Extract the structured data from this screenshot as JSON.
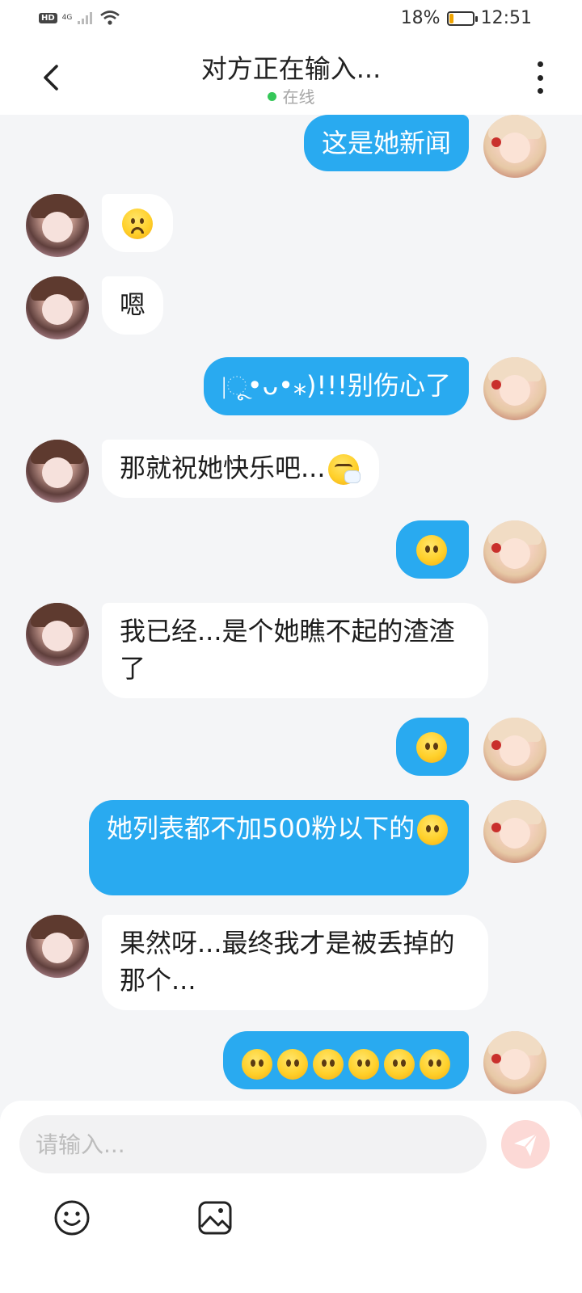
{
  "status_bar": {
    "network_badge": "HD",
    "signal_label": "4G",
    "battery_text": "18%",
    "battery_level": 0.18,
    "time": "12:51"
  },
  "header": {
    "title": "对方正在输入...",
    "status": "在线",
    "online_color": "#35c759"
  },
  "colors": {
    "my_bubble": "#29aaf0",
    "their_bubble": "#ffffff",
    "background": "#f4f5f7",
    "send_button": "#fcd9d6"
  },
  "messages": [
    {
      "side": "me",
      "text": "这是她新闻"
    },
    {
      "side": "them",
      "emoji": "frowning-face-emoji"
    },
    {
      "side": "them",
      "text": "嗯"
    },
    {
      "side": "me",
      "text": "|ૂ•ᴗ•⁎)!!!别伤心了"
    },
    {
      "side": "them",
      "text": "那就祝她快乐吧...",
      "emoji_after": "sneezing-face-emoji"
    },
    {
      "side": "me",
      "emoji": "neutral-face-emoji"
    },
    {
      "side": "them",
      "text": "我已经...是个她瞧不起的渣渣了"
    },
    {
      "side": "me",
      "emoji": "neutral-face-emoji"
    },
    {
      "side": "me",
      "text": "她列表都不加500粉以下的",
      "emoji_after": "neutral-face-emoji"
    },
    {
      "side": "them",
      "text": "果然呀...最终我才是被丢掉的那个..."
    },
    {
      "side": "me",
      "emoji_repeat": "neutral-face-emoji",
      "count": 6
    }
  ],
  "input": {
    "placeholder": "请输入..."
  }
}
